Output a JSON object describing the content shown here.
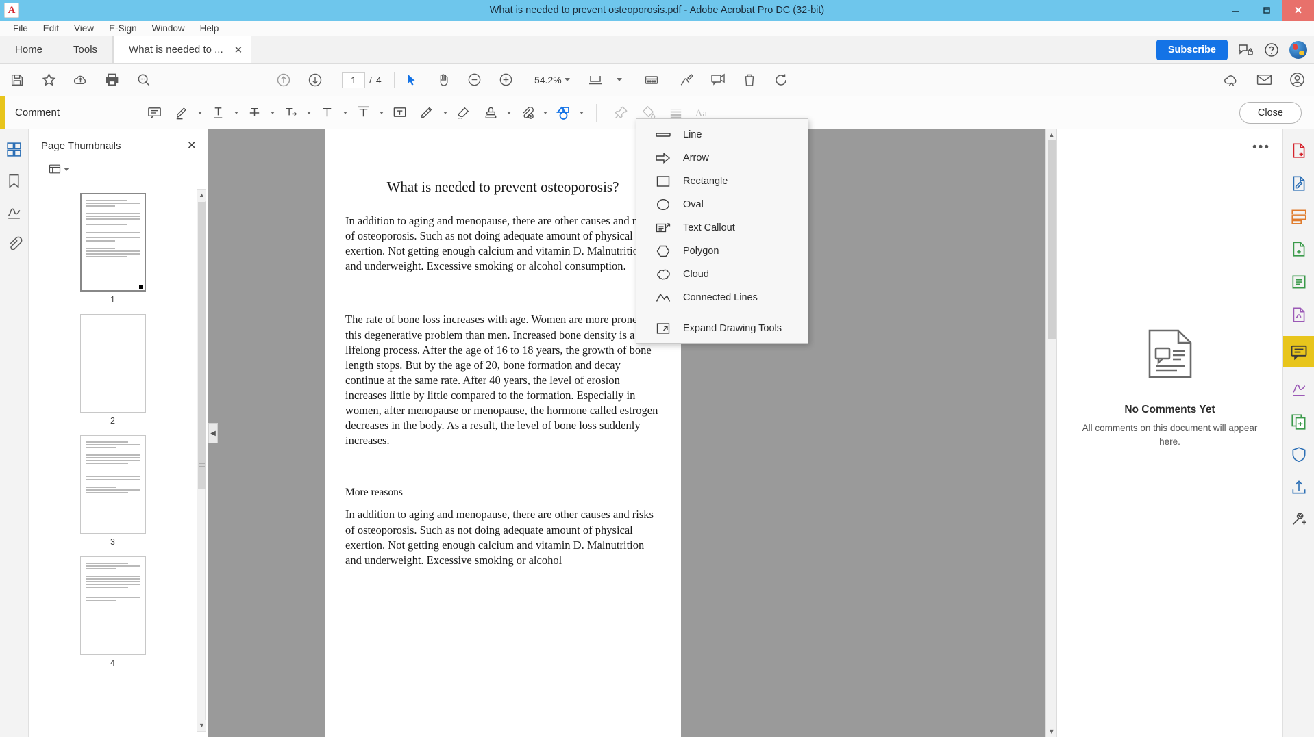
{
  "window": {
    "title": "What is needed to prevent osteoporosis.pdf - Adobe Acrobat Pro DC (32-bit)",
    "app_logo": "A",
    "minimize_label": "—",
    "maximize_label": "❐",
    "close_label": "✕"
  },
  "menubar": {
    "items": [
      {
        "label": "File"
      },
      {
        "label": "Edit"
      },
      {
        "label": "View"
      },
      {
        "label": "E-Sign"
      },
      {
        "label": "Window"
      },
      {
        "label": "Help"
      }
    ]
  },
  "tabs": {
    "home": "Home",
    "tools": "Tools",
    "document": "What is needed to ...",
    "document_close": "✕",
    "subscribe": "Subscribe",
    "share_icon": "share-thumbsup-icon",
    "help_icon": "help-question-icon",
    "avatar_icon": "user-avatar-globe-icon"
  },
  "toolbar": {
    "left_icons": [
      "save-icon",
      "star-favorite-icon",
      "upload-cloud-icon",
      "print-icon",
      "search-icon"
    ],
    "nav_icons": [
      "previous-page-icon",
      "next-page-icon"
    ],
    "page_current": "1",
    "page_separator": "/",
    "page_total": "4",
    "tool_icons": [
      "select-cursor-icon",
      "hand-pan-icon",
      "zoom-out-icon",
      "zoom-in-icon"
    ],
    "zoom_value": "54.2%",
    "fit_icon": "fit-page-icon",
    "read_mode_icon": "read-mode-icon",
    "right_icons": [
      "sign-icon",
      "stamp-comment-icon",
      "delete-trash-icon",
      "rotate-icon"
    ],
    "far_right_icons": [
      "cloud-sync-icon",
      "email-icon",
      "account-person-icon"
    ]
  },
  "commentbar": {
    "label": "Comment",
    "close_label": "Close",
    "tools": [
      {
        "name": "sticky-note-icon"
      },
      {
        "name": "highlight-pen-icon"
      },
      {
        "name": "underline-text-icon"
      },
      {
        "name": "strikethrough-text-icon"
      },
      {
        "name": "insert-text-icon"
      },
      {
        "name": "replace-text-icon"
      },
      {
        "name": "add-text-comment-icon"
      },
      {
        "name": "text-box-icon"
      },
      {
        "name": "draw-freehand-icon"
      },
      {
        "name": "eraser-icon"
      },
      {
        "name": "stamp-icon"
      },
      {
        "name": "attach-file-icon"
      },
      {
        "name": "drawing-tools-icon"
      },
      {
        "name": "pin-icon"
      },
      {
        "name": "fill-color-icon"
      },
      {
        "name": "line-thickness-icon"
      },
      {
        "name": "text-properties-icon"
      }
    ]
  },
  "dropdown": {
    "items": [
      {
        "label": "Line",
        "icon": "line-tool-icon"
      },
      {
        "label": "Arrow",
        "icon": "arrow-tool-icon"
      },
      {
        "label": "Rectangle",
        "icon": "rectangle-tool-icon"
      },
      {
        "label": "Oval",
        "icon": "oval-tool-icon"
      },
      {
        "label": "Text Callout",
        "icon": "text-callout-tool-icon"
      },
      {
        "label": "Polygon",
        "icon": "polygon-tool-icon"
      },
      {
        "label": "Cloud",
        "icon": "cloud-shape-tool-icon"
      },
      {
        "label": "Connected Lines",
        "icon": "connected-lines-tool-icon"
      }
    ],
    "expand": {
      "label": "Expand Drawing Tools",
      "icon": "expand-tools-icon"
    }
  },
  "leftrail": {
    "icons": [
      "page-thumbnails-icon",
      "bookmarks-icon",
      "signatures-icon",
      "attachments-icon"
    ]
  },
  "thumbnails": {
    "title": "Page Thumbnails",
    "close_label": "✕",
    "options_icon": "list-options-icon",
    "pages": [
      {
        "number": "1",
        "selected": true
      },
      {
        "number": "2",
        "selected": false
      },
      {
        "number": "3",
        "selected": false
      },
      {
        "number": "4",
        "selected": false
      }
    ]
  },
  "document": {
    "title": "What is needed to prevent osteoporosis?",
    "paragraph1": "In addition to aging and menopause, there are other causes and risks of osteoporosis. Such as not doing adequate amount of physical exertion. Not getting enough calcium and vitamin D. Malnutrition and underweight. Excessive smoking or alcohol consumption.",
    "paragraph2": "The rate of bone loss increases with age. Women are more prone to this degenerative problem than men. Increased bone density is a lifelong process. After the age of 16 to 18 years, the growth of bone length stops. But by the age of 20, bone formation and decay continue at the same rate. After 40 years, the level of erosion increases little by little compared to the formation. Especially in women, after menopause or menopause, the hormone called estrogen decreases in the body. As a result, the level of bone loss suddenly increases.",
    "subheading": "More reasons",
    "paragraph3": "In addition to aging and menopause, there are other causes and risks of osteoporosis. Such as not doing adequate amount of physical exertion. Not getting enough calcium and vitamin D. Malnutrition and underweight. Excessive smoking or alcohol"
  },
  "comments_panel": {
    "more_options": "•••",
    "empty_icon": "comments-document-icon",
    "empty_title": "No Comments Yet",
    "empty_subtitle": "All comments on this document will appear here."
  },
  "rightrail": {
    "icons": [
      "export-pdf-icon",
      "edit-pdf-icon",
      "organize-pages-icon",
      "create-pdf-icon",
      "compress-pdf-icon",
      "fill-sign-icon",
      "comment-icon",
      "sign-document-icon",
      "combine-files-icon",
      "protect-icon",
      "share-file-icon",
      "more-tools-icon"
    ]
  },
  "colors": {
    "titlebar": "#6ec6ec",
    "accent_blue": "#1473e6",
    "yellow_tab": "#e8c51c",
    "close_red": "#e8716b",
    "doc_backdrop": "#9a9a9a"
  }
}
